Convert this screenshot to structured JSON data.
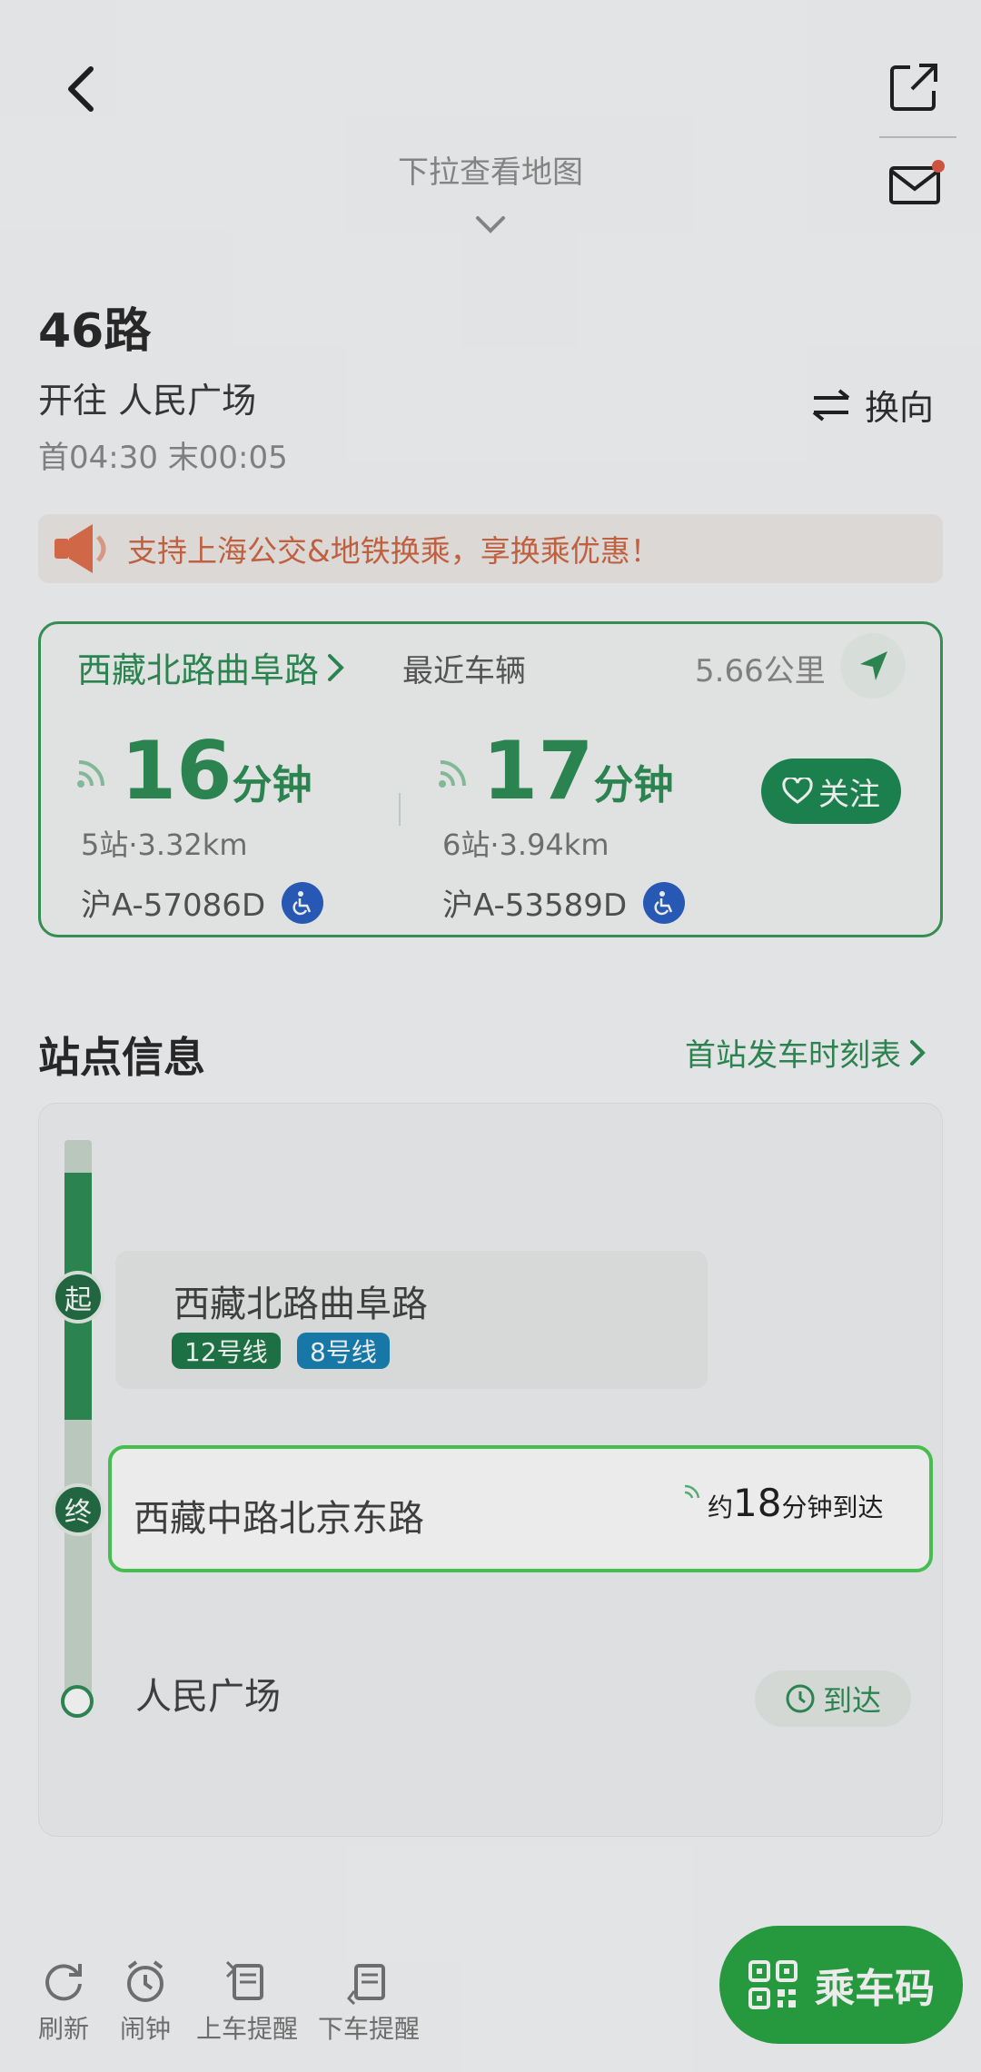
{
  "header": {
    "pull_hint": "下拉查看地图"
  },
  "route": {
    "name": "46路",
    "direction": "开往 人民广场",
    "service_time": "首04:30 末00:05",
    "swap_label": "换向"
  },
  "banner": {
    "text": "支持上海公交&地铁换乘，享换乘优惠！"
  },
  "vehicle_card": {
    "stop_name": "西藏北路曲阜路",
    "recent_label": "最近车辆",
    "distance": "5.66公里",
    "buses": [
      {
        "minutes": "16",
        "unit": "分钟",
        "meta": "5站·3.32km",
        "plate": "沪A-57086D"
      },
      {
        "minutes": "17",
        "unit": "分钟",
        "meta": "6站·3.94km",
        "plate": "沪A-53589D"
      }
    ],
    "follow_label": "关注"
  },
  "stations": {
    "title": "站点信息",
    "timetable_link": "首站发车时刻表",
    "list": [
      {
        "badge": "起",
        "name": "西藏北路曲阜路",
        "lines": [
          "12号线",
          "8号线"
        ]
      },
      {
        "badge": "终",
        "name": "西藏中路北京东路",
        "eta_prefix": "约",
        "eta_minutes": "18",
        "eta_suffix": "分钟到达"
      },
      {
        "name": "人民广场",
        "action": "到达"
      }
    ]
  },
  "toolbar": {
    "refresh": "刷新",
    "alarm": "闹钟",
    "board_reminder": "上车提醒",
    "alight_reminder": "下车提醒",
    "ride_code": "乘车码"
  },
  "colors": {
    "brand_green": "#2f8f57",
    "ride_button": "#2aa544",
    "banner_text": "#d06a47",
    "line12": "#1f7a4a",
    "line8": "#1a82b5"
  }
}
